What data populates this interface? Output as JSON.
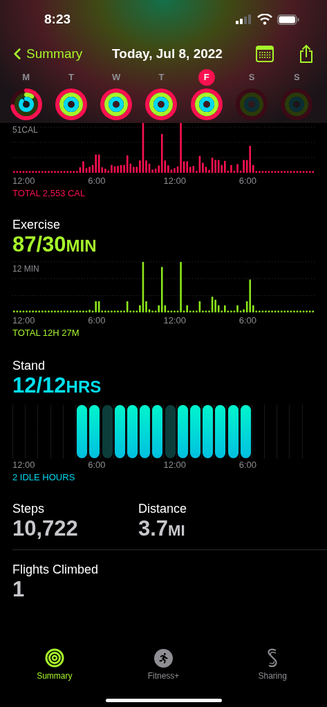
{
  "status_bar": {
    "time": "8:23"
  },
  "nav": {
    "back": "Summary",
    "title": "Today, Jul 8, 2022"
  },
  "week": [
    {
      "day": "M",
      "selected": false,
      "kind": "partial"
    },
    {
      "day": "T",
      "selected": false,
      "kind": "closed"
    },
    {
      "day": "W",
      "selected": false,
      "kind": "closed"
    },
    {
      "day": "T",
      "selected": false,
      "kind": "closed"
    },
    {
      "day": "F",
      "selected": true,
      "kind": "closed"
    },
    {
      "day": "S",
      "selected": false,
      "kind": "empty"
    },
    {
      "day": "S",
      "selected": false,
      "kind": "empty"
    }
  ],
  "move": {
    "scale": "51CAL",
    "x_labels": [
      "12:00",
      "6:00",
      "12:00",
      "6:00"
    ],
    "total": "TOTAL 2,553 CAL"
  },
  "exercise": {
    "title": "Exercise",
    "value": "87/30",
    "unit": "MIN",
    "scale": "12 MIN",
    "x_labels": [
      "12:00",
      "6:00",
      "12:00",
      "6:00"
    ],
    "total": "TOTAL 12H 27M"
  },
  "stand": {
    "title": "Stand",
    "value": "12/12",
    "unit": "HRS",
    "hours": [
      {
        "kind": "none"
      },
      {
        "kind": "none"
      },
      {
        "kind": "none"
      },
      {
        "kind": "none"
      },
      {
        "kind": "none"
      },
      {
        "kind": "stood"
      },
      {
        "kind": "stood"
      },
      {
        "kind": "idle"
      },
      {
        "kind": "stood"
      },
      {
        "kind": "stood"
      },
      {
        "kind": "stood"
      },
      {
        "kind": "stood"
      },
      {
        "kind": "idle"
      },
      {
        "kind": "stood"
      },
      {
        "kind": "stood"
      },
      {
        "kind": "stood"
      },
      {
        "kind": "stood"
      },
      {
        "kind": "stood"
      },
      {
        "kind": "stood"
      },
      {
        "kind": "none"
      },
      {
        "kind": "none"
      },
      {
        "kind": "none"
      },
      {
        "kind": "none"
      },
      {
        "kind": "none"
      }
    ],
    "x_labels": [
      "12:00",
      "6:00",
      "12:00",
      "6:00"
    ],
    "idle": "2 IDLE HOURS"
  },
  "stats": [
    {
      "label": "Steps",
      "value": "10,722"
    },
    {
      "label": "Distance",
      "value": "3.7",
      "unit": "MI"
    }
  ],
  "flights": {
    "label": "Flights Climbed",
    "value": "1"
  },
  "tabs": [
    {
      "label": "Summary",
      "kind": "summary",
      "selected": true
    },
    {
      "label": "Fitness+",
      "kind": "fitness",
      "selected": false
    },
    {
      "label": "Sharing",
      "kind": "sharing",
      "selected": false
    }
  ]
}
